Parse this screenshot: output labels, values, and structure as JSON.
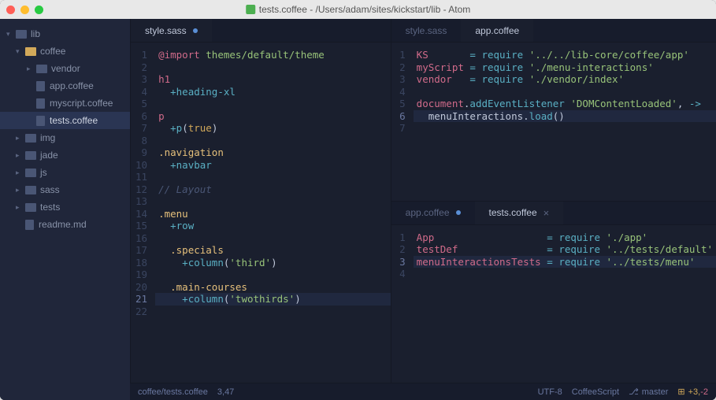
{
  "window": {
    "title": "tests.coffee - /Users/adam/sites/kickstart/lib - Atom"
  },
  "sidebar": {
    "root": "lib",
    "items": [
      {
        "label": "coffee",
        "type": "folder-open",
        "indent": 1,
        "caret": "▾"
      },
      {
        "label": "vendor",
        "type": "folder",
        "indent": 2,
        "caret": "▸"
      },
      {
        "label": "app.coffee",
        "type": "file",
        "indent": 2
      },
      {
        "label": "myscript.coffee",
        "type": "file",
        "indent": 2
      },
      {
        "label": "tests.coffee",
        "type": "file",
        "indent": 2,
        "selected": true
      },
      {
        "label": "img",
        "type": "folder",
        "indent": 1,
        "caret": "▸"
      },
      {
        "label": "jade",
        "type": "folder",
        "indent": 1,
        "caret": "▸"
      },
      {
        "label": "js",
        "type": "folder",
        "indent": 1,
        "caret": "▸"
      },
      {
        "label": "sass",
        "type": "folder",
        "indent": 1,
        "caret": "▸"
      },
      {
        "label": "tests",
        "type": "folder",
        "indent": 1,
        "caret": "▸"
      },
      {
        "label": "readme.md",
        "type": "file",
        "indent": 1
      }
    ]
  },
  "pane_left": {
    "tabs": [
      {
        "label": "style.sass",
        "active": true,
        "modified": true
      }
    ],
    "lines": [
      {
        "n": 1,
        "html": "<span class='c-key'>@import</span> <span class='c-str'>themes/default/theme</span>"
      },
      {
        "n": 2,
        "html": ""
      },
      {
        "n": 3,
        "html": "<span class='c-tag'>h1</span>"
      },
      {
        "n": 4,
        "html": "  <span class='c-func'>+heading-xl</span>"
      },
      {
        "n": 5,
        "html": ""
      },
      {
        "n": 6,
        "html": "<span class='c-tag'>p</span>"
      },
      {
        "n": 7,
        "html": "  <span class='c-func'>+p</span>(<span class='c-bool'>true</span>)"
      },
      {
        "n": 8,
        "html": ""
      },
      {
        "n": 9,
        "html": "<span class='c-class'>.navigation</span>"
      },
      {
        "n": 10,
        "html": "  <span class='c-func'>+navbar</span>"
      },
      {
        "n": 11,
        "html": ""
      },
      {
        "n": 12,
        "html": "<span class='c-comment'>// Layout</span>"
      },
      {
        "n": 13,
        "html": ""
      },
      {
        "n": 14,
        "html": "<span class='c-class'>.menu</span>"
      },
      {
        "n": 15,
        "html": "  <span class='c-func'>+row</span>"
      },
      {
        "n": 16,
        "html": ""
      },
      {
        "n": 17,
        "html": "  <span class='c-class'>.specials</span>"
      },
      {
        "n": 18,
        "html": "    <span class='c-func'>+column</span>(<span class='c-str'>'third'</span>)"
      },
      {
        "n": 19,
        "html": ""
      },
      {
        "n": 20,
        "html": "  <span class='c-class'>.main-courses</span>"
      },
      {
        "n": 21,
        "html": "    <span class='c-func'>+column</span>(<span class='c-str'>'twothirds'</span>)",
        "hl": true
      },
      {
        "n": 22,
        "html": ""
      }
    ]
  },
  "pane_tr": {
    "tabs": [
      {
        "label": "style.sass",
        "active": false
      },
      {
        "label": "app.coffee",
        "active": true
      }
    ],
    "lines": [
      {
        "n": 1,
        "html": "<span class='c-var'>KS</span>       <span class='c-op'>=</span> <span class='c-call'>require</span> <span class='c-str'>'../../lib-core/coffee/app'</span>"
      },
      {
        "n": 2,
        "html": "<span class='c-var'>myScript</span> <span class='c-op'>=</span> <span class='c-call'>require</span> <span class='c-str'>'./menu-interactions'</span>"
      },
      {
        "n": 3,
        "html": "<span class='c-var'>vendor</span>   <span class='c-op'>=</span> <span class='c-call'>require</span> <span class='c-str'>'./vendor/index'</span>"
      },
      {
        "n": 4,
        "html": ""
      },
      {
        "n": 5,
        "html": "<span class='c-var'>document</span>.<span class='c-call'>addEventListener</span> <span class='c-str'>'DOMContentLoaded'</span>, <span class='c-op'>-&gt;</span>"
      },
      {
        "n": 6,
        "html": "  menuInteractions.<span class='c-call'>load</span>()",
        "hl": true
      },
      {
        "n": 7,
        "html": ""
      }
    ]
  },
  "pane_br": {
    "tabs": [
      {
        "label": "app.coffee",
        "active": false,
        "modified": true
      },
      {
        "label": "tests.coffee",
        "active": true,
        "close": true
      }
    ],
    "lines": [
      {
        "n": 1,
        "html": "<span class='c-var'>App</span>                   <span class='c-op'>=</span> <span class='c-call'>require</span> <span class='c-str'>'./app'</span>"
      },
      {
        "n": 2,
        "html": "<span class='c-var'>testDef</span>               <span class='c-op'>=</span> <span class='c-call'>require</span> <span class='c-str'>'../tests/default'</span>"
      },
      {
        "n": 3,
        "html": "<span class='c-var'>menuInteractionsTests</span> <span class='c-op'>=</span> <span class='c-call'>require</span> <span class='c-str'>'../tests/menu'</span>",
        "hl": true
      },
      {
        "n": 4,
        "html": ""
      }
    ]
  },
  "statusbar": {
    "path": "coffee/tests.coffee",
    "cursor": "3,47",
    "encoding": "UTF-8",
    "language": "CoffeeScript",
    "branch_icon": "⎇",
    "branch": "master",
    "git_icon": "⊞",
    "git_add": "+3,",
    "git_del": "-2"
  }
}
